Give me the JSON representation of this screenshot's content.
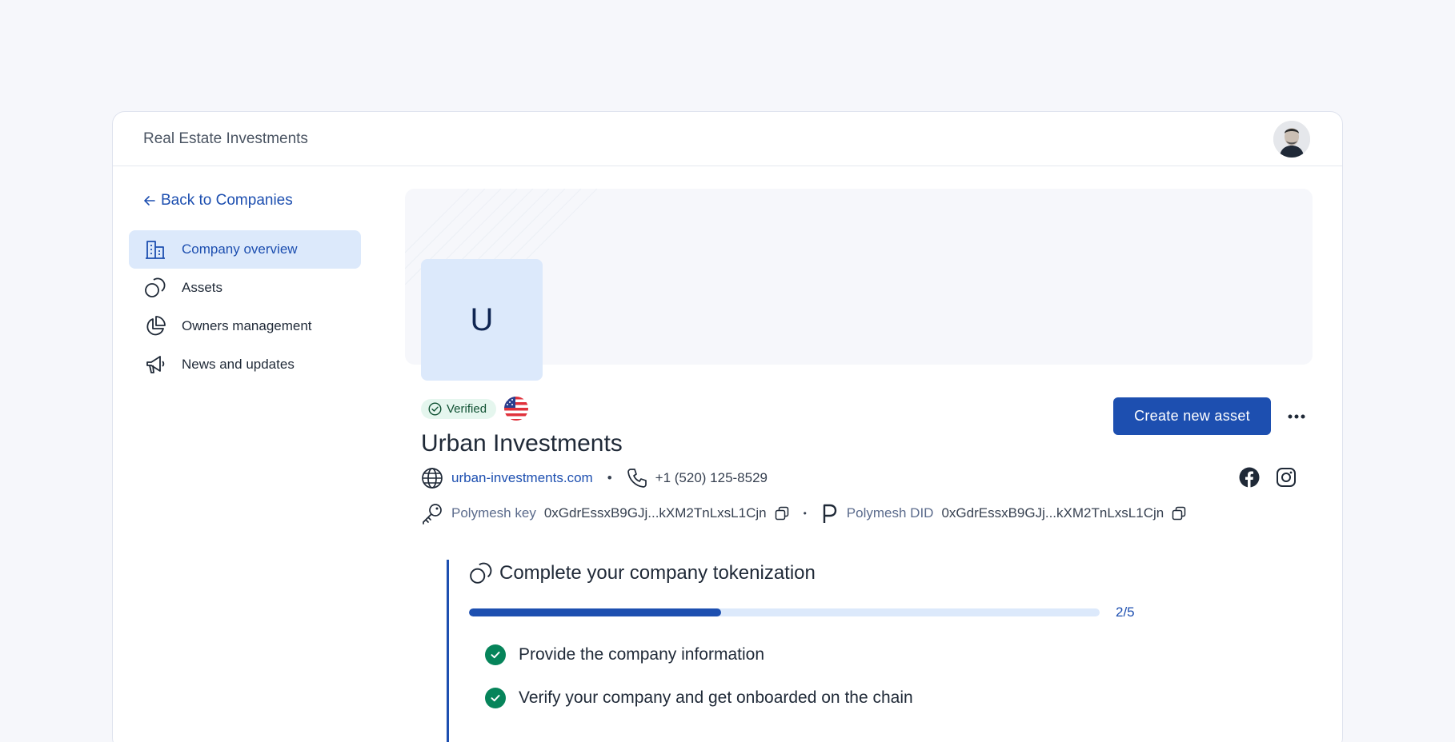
{
  "app": {
    "title": "Real Estate Investments"
  },
  "sidebar": {
    "back_label": "Back to Companies",
    "items": [
      {
        "label": "Company overview",
        "icon": "building-icon",
        "active": true
      },
      {
        "label": "Assets",
        "icon": "coins-icon",
        "active": false
      },
      {
        "label": "Owners management",
        "icon": "pie-chart-icon",
        "active": false
      },
      {
        "label": "News and updates",
        "icon": "megaphone-icon",
        "active": false
      }
    ]
  },
  "company": {
    "logo_letter": "U",
    "verified_label": "Verified",
    "country_flag": "us-flag-icon",
    "name": "Urban Investments",
    "website": "urban-investments.com",
    "phone": "+1 (520) 125-8529",
    "polymesh_key_label": "Polymesh key",
    "polymesh_key_value": "0xGdrEssxB9GJj...kXM2TnLxsL1Cjn",
    "polymesh_did_label": "Polymesh DID",
    "polymesh_did_value": "0xGdrEssxB9GJj...kXM2TnLxsL1Cjn"
  },
  "actions": {
    "create_asset_label": "Create new asset"
  },
  "tokenization": {
    "title": "Complete your company tokenization",
    "progress_text": "2/5",
    "progress_fraction": 0.4,
    "steps": [
      {
        "label": "Provide the company information",
        "done": true
      },
      {
        "label": "Verify your company and get onboarded on the chain",
        "done": true
      }
    ]
  },
  "colors": {
    "accent": "#1d4fb0",
    "success": "#06845a",
    "nav_active_bg": "#dce9fb"
  }
}
